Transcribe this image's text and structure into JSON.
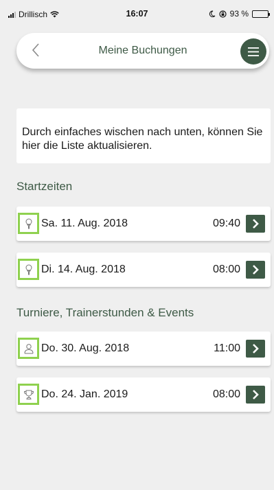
{
  "status_bar": {
    "carrier": "Drillisch",
    "time": "16:07",
    "battery_text": "93 %"
  },
  "nav": {
    "back_icon": "chevron-left-icon",
    "title": "Meine Buchungen",
    "menu_icon": "hamburger-menu-icon"
  },
  "info": {
    "text": "Durch einfaches wischen nach unten, können Sie hier die Liste aktualisieren."
  },
  "sections": {
    "start_times": {
      "title": "Startzeiten",
      "items": [
        {
          "icon": "golf-tee-icon",
          "date": "Sa. 11. Aug. 2018",
          "time": "09:40"
        },
        {
          "icon": "golf-tee-icon",
          "date": "Di. 14. Aug. 2018",
          "time": "08:00"
        }
      ]
    },
    "events": {
      "title": "Turniere, Trainerstunden & Events",
      "items": [
        {
          "icon": "trainer-person-icon",
          "date": "Do. 30. Aug. 2018",
          "time": "11:00"
        },
        {
          "icon": "trophy-icon",
          "date": "Do. 24. Jan. 2019",
          "time": "08:00"
        }
      ]
    }
  },
  "colors": {
    "accent": "#3e5a46",
    "highlight": "#8fd14f",
    "background": "#efefef"
  }
}
